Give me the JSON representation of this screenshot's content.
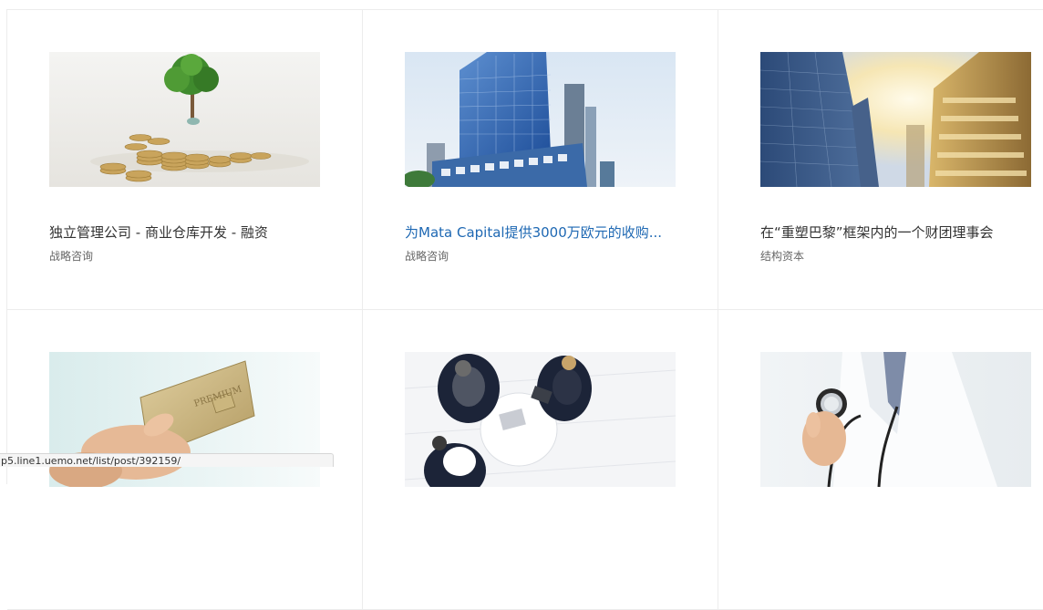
{
  "cards": [
    {
      "title": "独立管理公司 - 商业仓库开发 - 融资",
      "category": "战略咨询",
      "image": "tree-coins-image"
    },
    {
      "title": "为Mata Capital提供3000万欧元的收购...",
      "category": "战略咨询",
      "image": "glass-tower-image"
    },
    {
      "title": "在“重塑巴黎”框架内的一个财团理事会",
      "category": "结构资本",
      "image": "skyscrapers-sun-image"
    },
    {
      "title": "",
      "category": "",
      "image": "credit-card-image"
    },
    {
      "title": "",
      "category": "",
      "image": "business-meeting-image"
    },
    {
      "title": "",
      "category": "",
      "image": "doctor-stethoscope-image"
    }
  ],
  "status_url": "p5.line1.uemo.net/list/post/392159/",
  "colors": {
    "hover_title": "#1e68b3",
    "title": "#333333",
    "category": "#666666",
    "border": "#ececec"
  }
}
